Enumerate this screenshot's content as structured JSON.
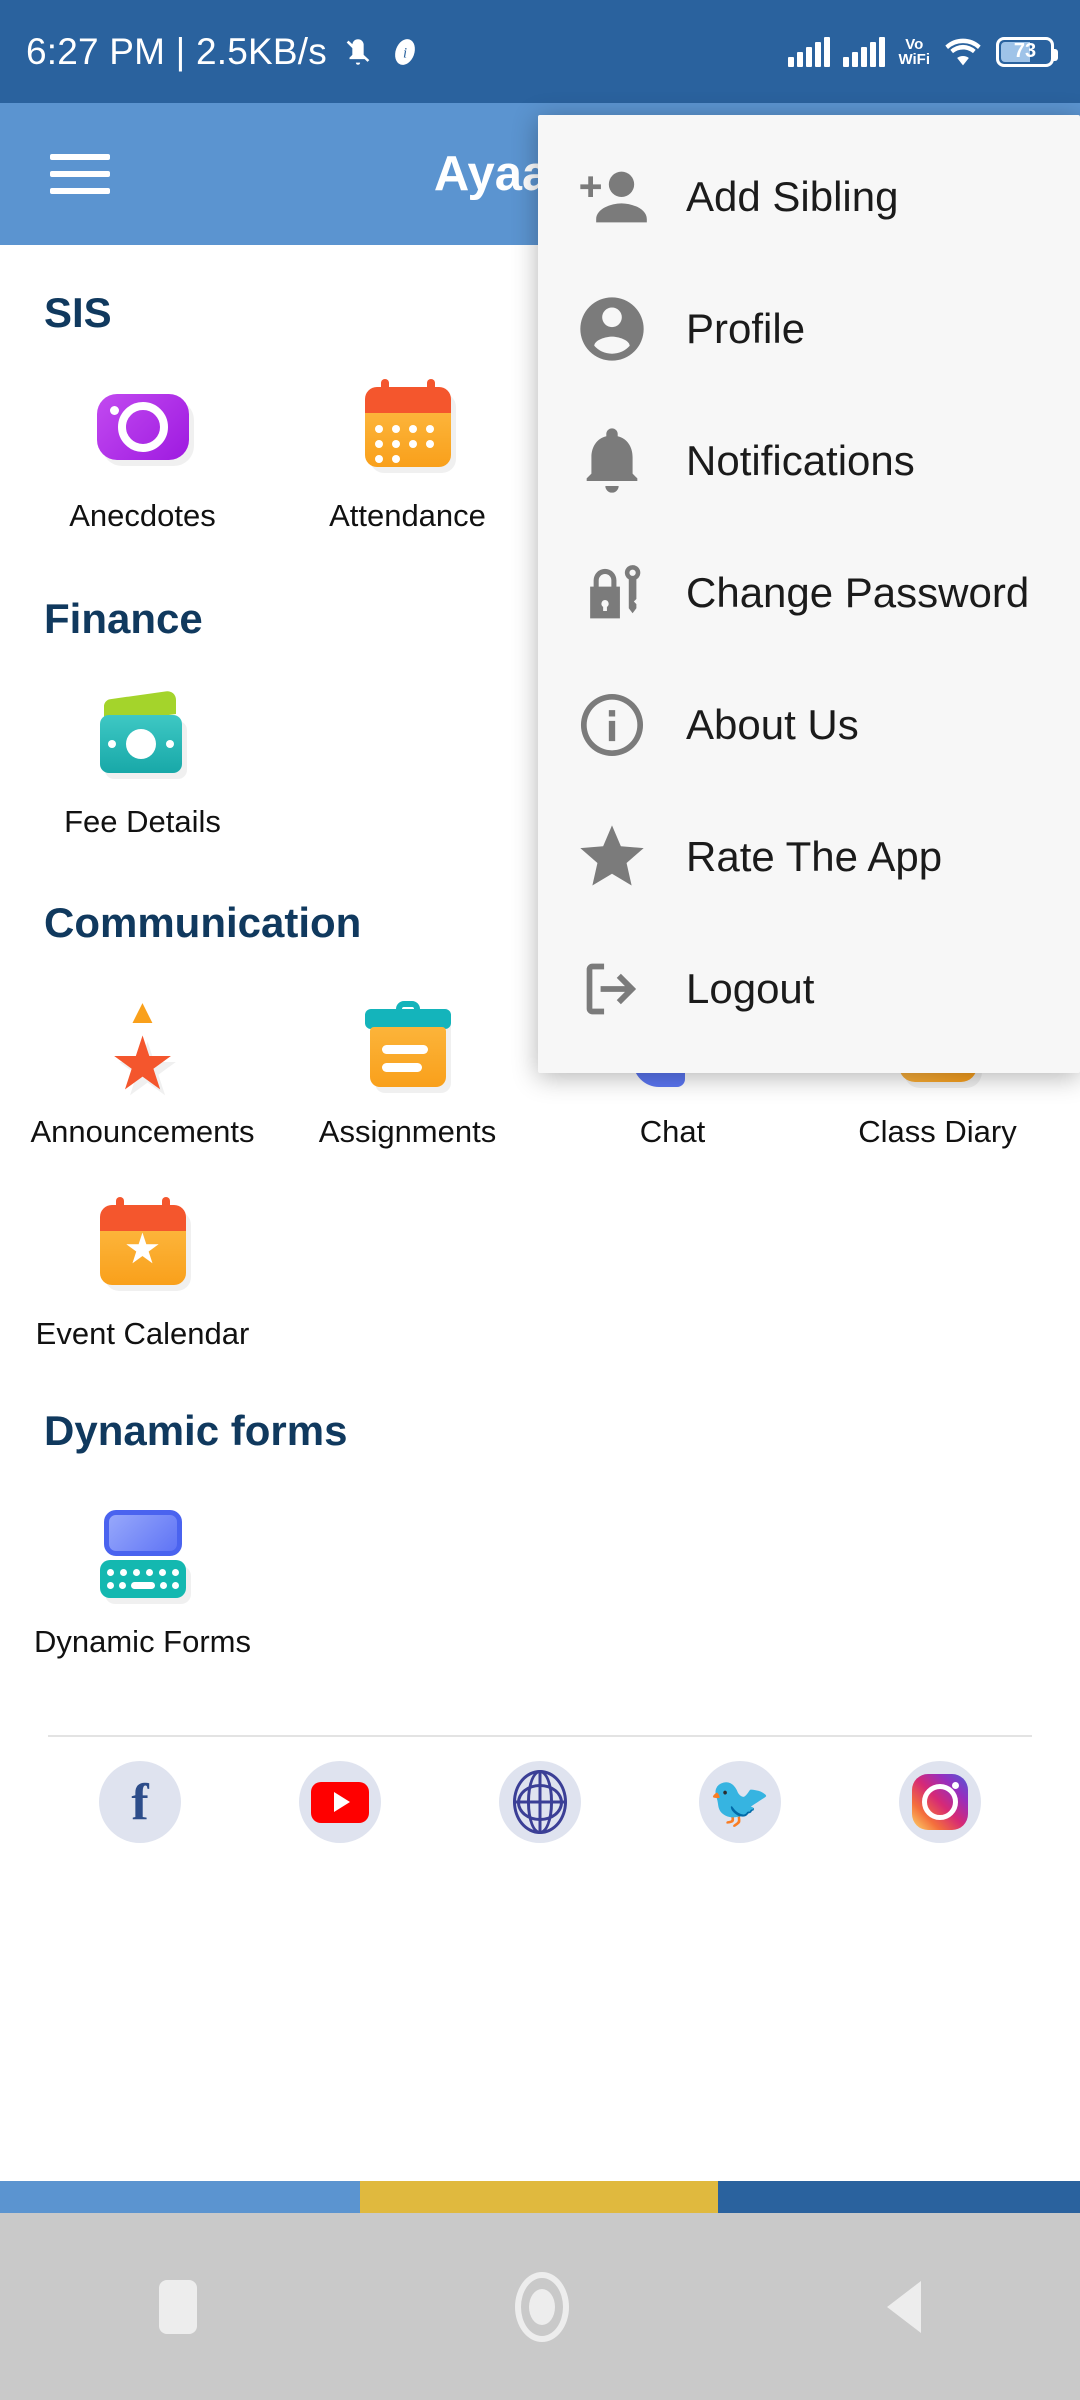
{
  "status_bar": {
    "clock": "6:27 PM | 2.5KB/s",
    "icons": [
      "mute-icon",
      "data-saver-icon",
      "signal-bars-sim1",
      "signal-bars-sim2",
      "volte-wifi-icon",
      "wifi-icon"
    ],
    "vowifi_top": "Vo",
    "vowifi_bottom": "WiFi",
    "battery_percent": "73"
  },
  "app_bar": {
    "menu_icon": "hamburger-icon",
    "title": "Ayaan Institut",
    "background_color": "#5b94d0"
  },
  "overflow_menu": {
    "visible": true,
    "items": [
      {
        "label": "Add Sibling",
        "icon": "person-add-icon"
      },
      {
        "label": "Profile",
        "icon": "account-circle-icon"
      },
      {
        "label": "Notifications",
        "icon": "bell-icon"
      },
      {
        "label": "Change Password",
        "icon": "lock-key-icon"
      },
      {
        "label": "About Us",
        "icon": "info-circle-icon"
      },
      {
        "label": "Rate The App",
        "icon": "star-icon"
      },
      {
        "label": "Logout",
        "icon": "logout-icon"
      }
    ]
  },
  "sections": [
    {
      "title": "SIS",
      "tiles": [
        {
          "label": "Anecdotes",
          "icon": "camera-icon"
        },
        {
          "label": "Attendance",
          "icon": "calendar-icon"
        }
      ]
    },
    {
      "title": "Finance",
      "tiles": [
        {
          "label": "Fee Details",
          "icon": "money-wallet-icon"
        }
      ]
    },
    {
      "title": "Communication",
      "tiles": [
        {
          "label": "Announcements",
          "icon": "star-burst-icon"
        },
        {
          "label": "Assignments",
          "icon": "clipboard-icon"
        },
        {
          "label": "Chat",
          "icon": "chat-bubbles-icon"
        },
        {
          "label": "Class Diary",
          "icon": "document-lines-icon"
        },
        {
          "label": "Event Calendar",
          "icon": "calendar-star-icon"
        }
      ]
    },
    {
      "title": "Dynamic forms",
      "tiles": [
        {
          "label": "Dynamic Forms",
          "icon": "form-keyboard-icon"
        }
      ]
    }
  ],
  "social_links": [
    {
      "name": "facebook-icon"
    },
    {
      "name": "youtube-icon"
    },
    {
      "name": "website-globe-icon"
    },
    {
      "name": "twitter-icon"
    },
    {
      "name": "instagram-icon"
    }
  ],
  "bottom_strip_colors": [
    "#5b94d0",
    "#e0b93e",
    "#2a629e"
  ],
  "android_nav": {
    "recents": "recents-square-icon",
    "home": "home-circle-icon",
    "back": "back-triangle-icon"
  },
  "theme": {
    "status_bar_bg": "#2a629e",
    "app_bar_bg": "#5b94d0",
    "section_title_color": "#10395e",
    "menu_bg": "#f7f7f7",
    "nav_bar_bg": "#c9c9c9"
  }
}
